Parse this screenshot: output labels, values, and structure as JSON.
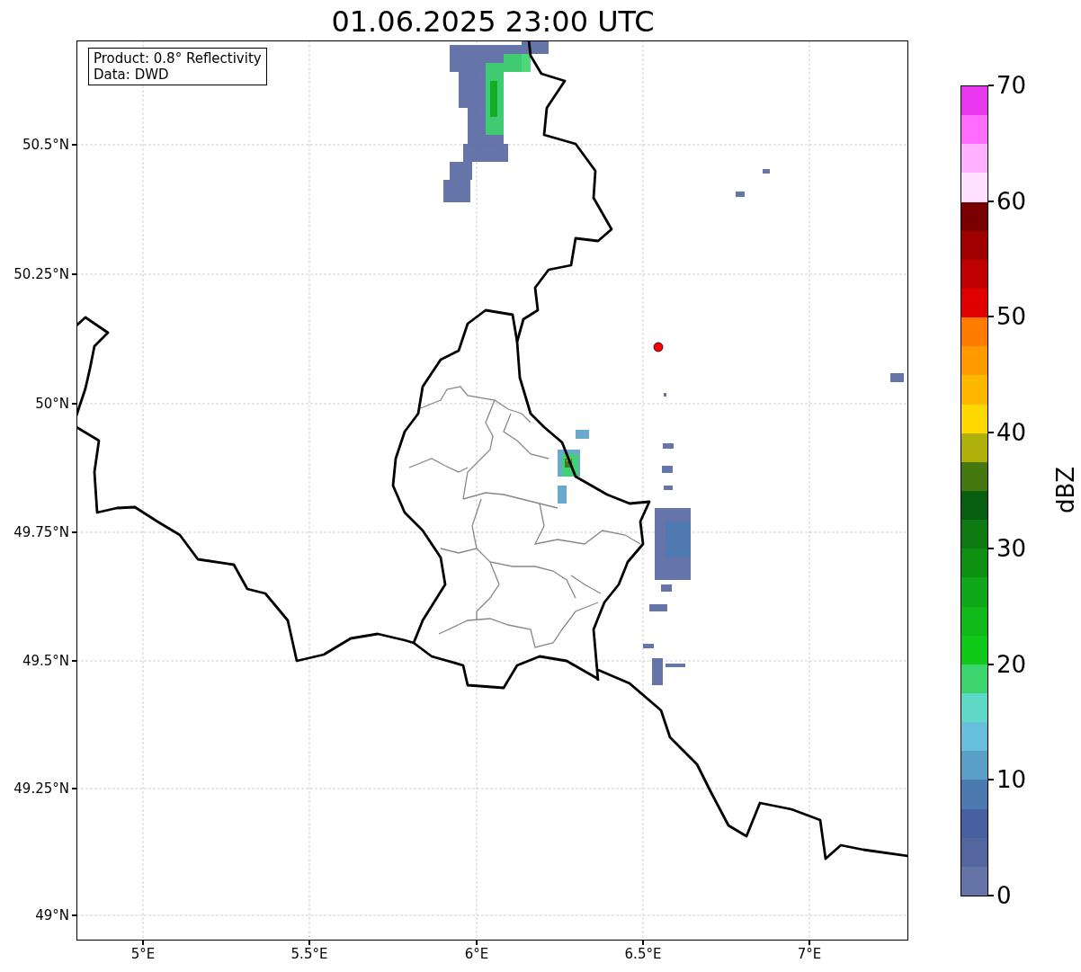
{
  "title": "01.06.2025 23:00 UTC",
  "info_box": {
    "lines": [
      "Product: 0.8° Reflectivity",
      "Data: DWD"
    ]
  },
  "map": {
    "x_ticks": [
      "5°E",
      "5.5°E",
      "6°E",
      "6.5°E",
      "7°E"
    ],
    "y_ticks": [
      "50.5°N",
      "50.25°N",
      "50°N",
      "49.75°N",
      "49.5°N",
      "49.25°N",
      "49°N"
    ]
  },
  "colorbar": {
    "label": "dBZ",
    "ticks": [
      "70",
      "60",
      "50",
      "40",
      "30",
      "20",
      "10",
      "0"
    ],
    "bins": [
      {
        "color": "#e838f0"
      },
      {
        "color": "#ff6cff"
      },
      {
        "color": "#ffb0ff"
      },
      {
        "color": "#ffe0ff"
      },
      {
        "color": "#780000"
      },
      {
        "color": "#a00000"
      },
      {
        "color": "#c00000"
      },
      {
        "color": "#e00000"
      },
      {
        "color": "#ff7c00"
      },
      {
        "color": "#ff9a00"
      },
      {
        "color": "#ffb800"
      },
      {
        "color": "#ffd800"
      },
      {
        "color": "#b0b00a"
      },
      {
        "color": "#467810"
      },
      {
        "color": "#085e10"
      },
      {
        "color": "#0c7a10"
      },
      {
        "color": "#0d9010"
      },
      {
        "color": "#10a818"
      },
      {
        "color": "#10b818"
      },
      {
        "color": "#10c818"
      },
      {
        "color": "#3cd46c"
      },
      {
        "color": "#60d8c8"
      },
      {
        "color": "#66c0dc"
      },
      {
        "color": "#5a9fc8"
      },
      {
        "color": "#4c7ab0"
      },
      {
        "color": "#4660a0"
      },
      {
        "color": "#5466a0"
      },
      {
        "color": "#6574a6"
      }
    ]
  }
}
